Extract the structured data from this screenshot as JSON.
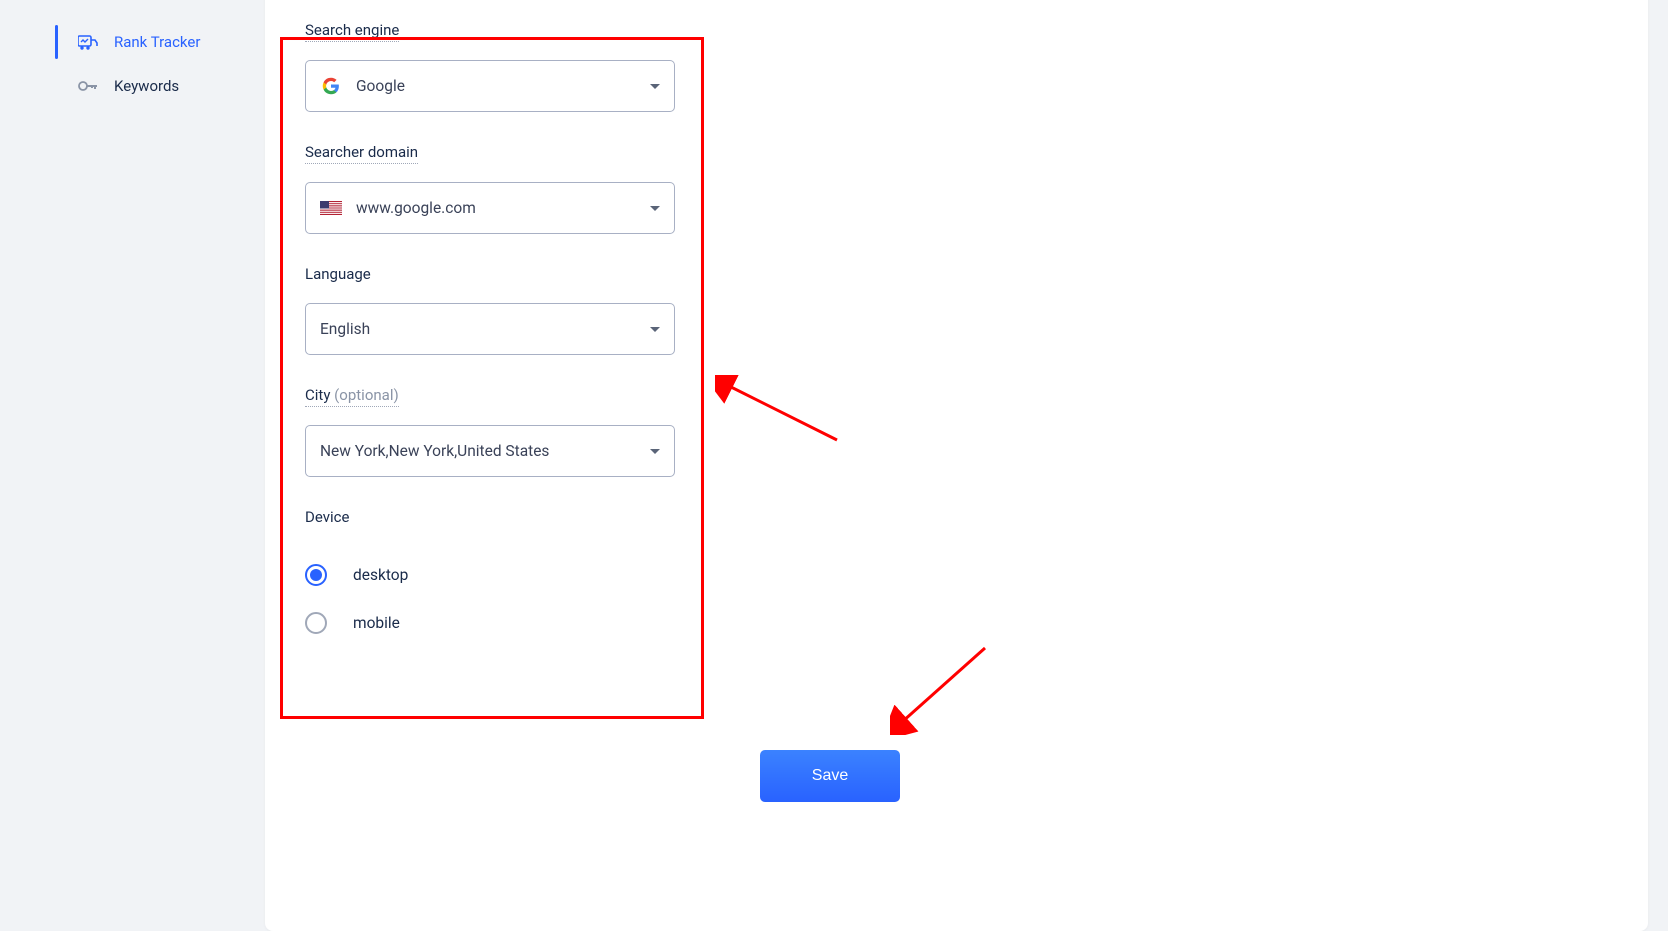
{
  "sidebar": {
    "items": [
      {
        "label": "Rank Tracker",
        "active": true
      },
      {
        "label": "Keywords",
        "active": false
      }
    ]
  },
  "form": {
    "search_engine": {
      "label": "Search engine",
      "value": "Google"
    },
    "searcher_domain": {
      "label": "Searcher domain",
      "value": "www.google.com"
    },
    "language": {
      "label": "Language",
      "value": "English"
    },
    "city": {
      "label": "City",
      "optional_suffix": "(optional)",
      "value": "New York,New York,United States"
    },
    "device": {
      "label": "Device",
      "options": [
        {
          "label": "desktop",
          "selected": true
        },
        {
          "label": "mobile",
          "selected": false
        }
      ]
    }
  },
  "actions": {
    "save_label": "Save"
  }
}
